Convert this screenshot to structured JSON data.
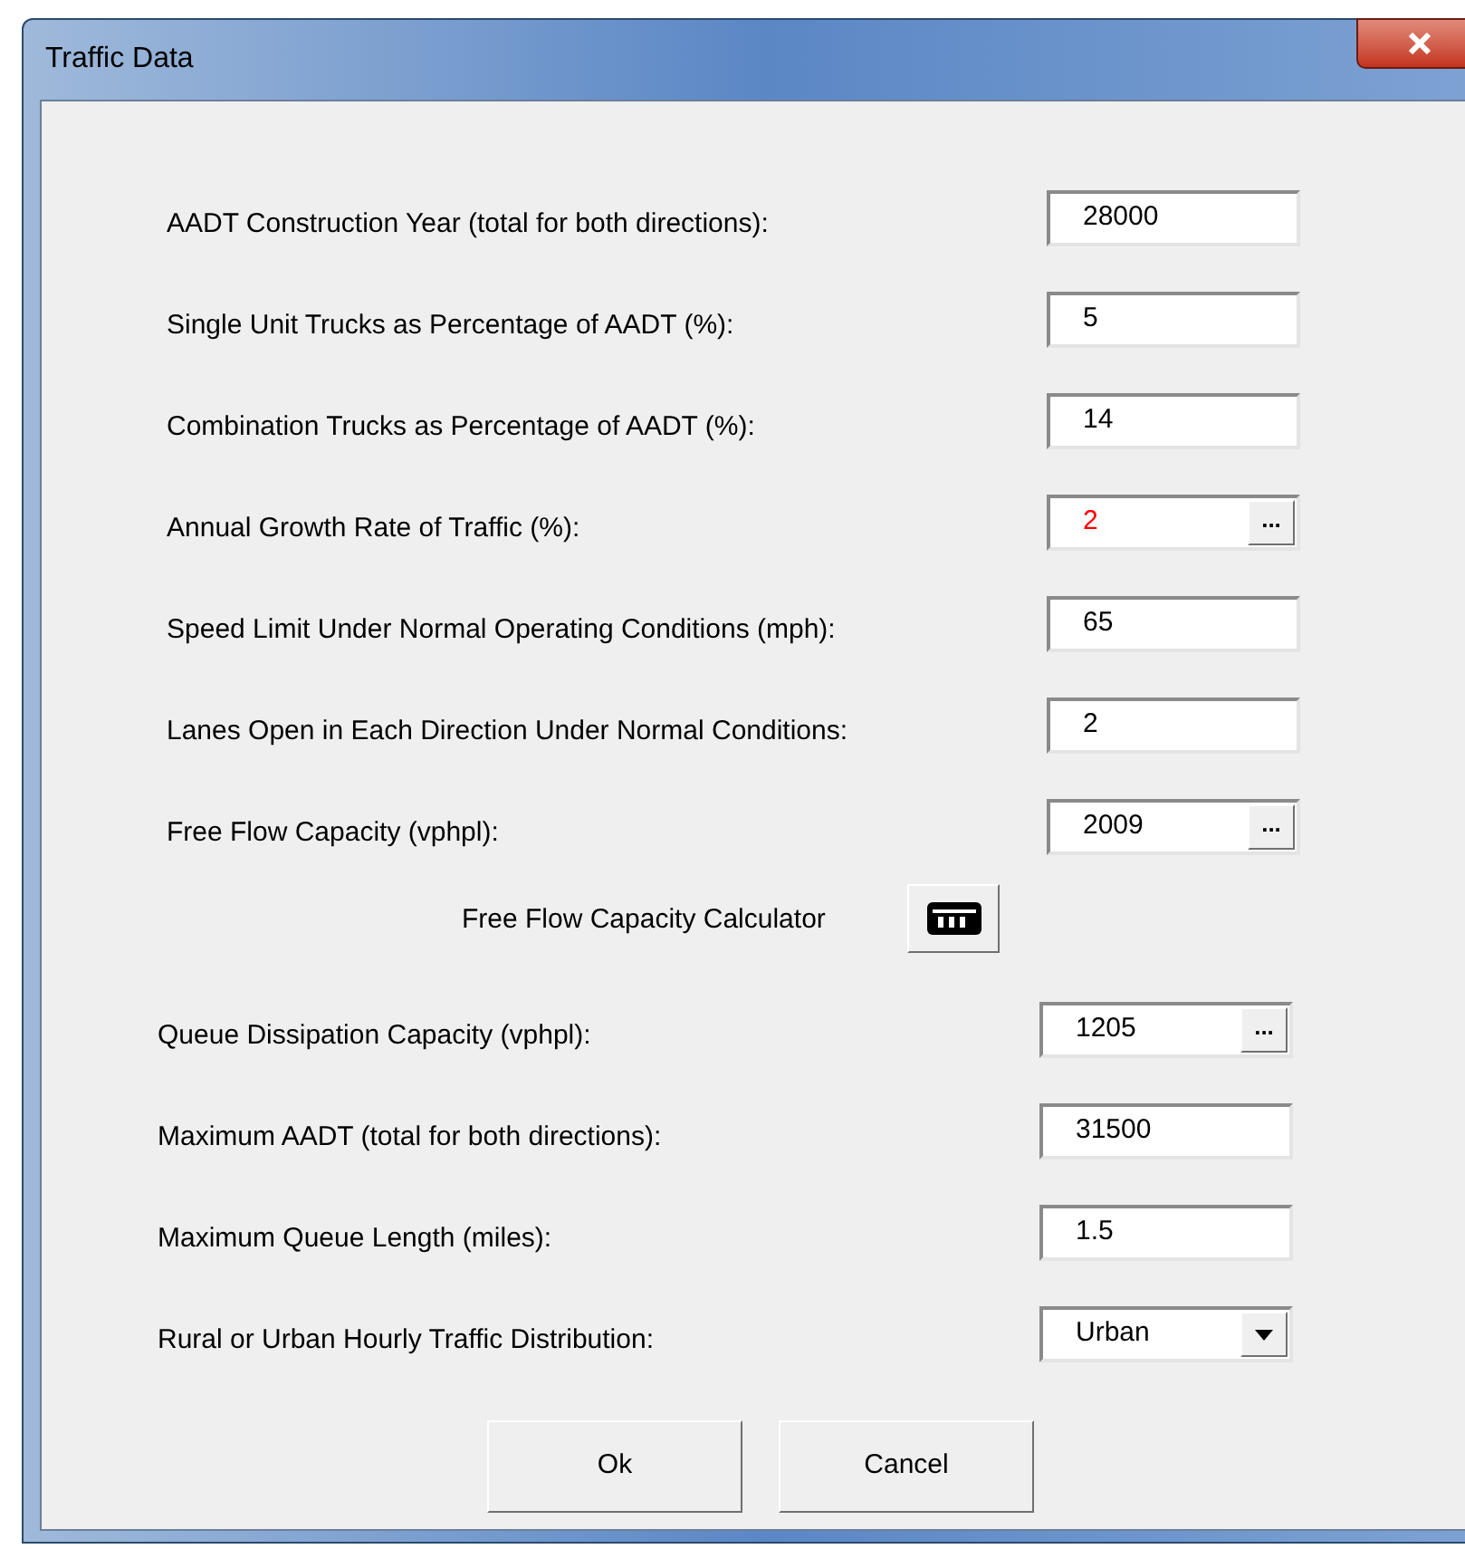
{
  "window": {
    "title": "Traffic Data"
  },
  "fields_top": [
    {
      "label": "AADT Construction Year (total for both directions):",
      "value": "28000",
      "kind": "text",
      "color": "#000000"
    },
    {
      "label": "Single Unit Trucks as Percentage of AADT (%):",
      "value": "5",
      "kind": "text",
      "color": "#000000"
    },
    {
      "label": "Combination Trucks as Percentage of AADT (%):",
      "value": "14",
      "kind": "text",
      "color": "#000000"
    },
    {
      "label": "Annual Growth Rate of Traffic (%):",
      "value": "2",
      "kind": "browse",
      "color": "#ff0000",
      "button": "..."
    },
    {
      "label": "Speed Limit Under Normal Operating Conditions (mph):",
      "value": "65",
      "kind": "text",
      "color": "#000000"
    },
    {
      "label": "Lanes Open in Each Direction Under Normal Conditions:",
      "value": "2",
      "kind": "text",
      "color": "#000000"
    },
    {
      "label": "Free Flow Capacity (vphpl):",
      "value": "2009",
      "kind": "browse",
      "color": "#000000",
      "button": "..."
    }
  ],
  "calculator": {
    "label": "Free Flow Capacity Calculator"
  },
  "fields_bottom": [
    {
      "label": "Queue Dissipation Capacity (vphpl):",
      "value": "1205",
      "kind": "browse",
      "color": "#000000",
      "button": "..."
    },
    {
      "label": "Maximum AADT (total for both directions):",
      "value": "31500",
      "kind": "text",
      "color": "#000000"
    },
    {
      "label": "Maximum Queue Length (miles):",
      "value": "1.5",
      "kind": "text",
      "color": "#000000"
    },
    {
      "label": "Rural or Urban Hourly Traffic Distribution:",
      "value": "Urban",
      "kind": "dropdown",
      "color": "#000000"
    }
  ],
  "buttons": [
    "Ok",
    "Cancel"
  ]
}
